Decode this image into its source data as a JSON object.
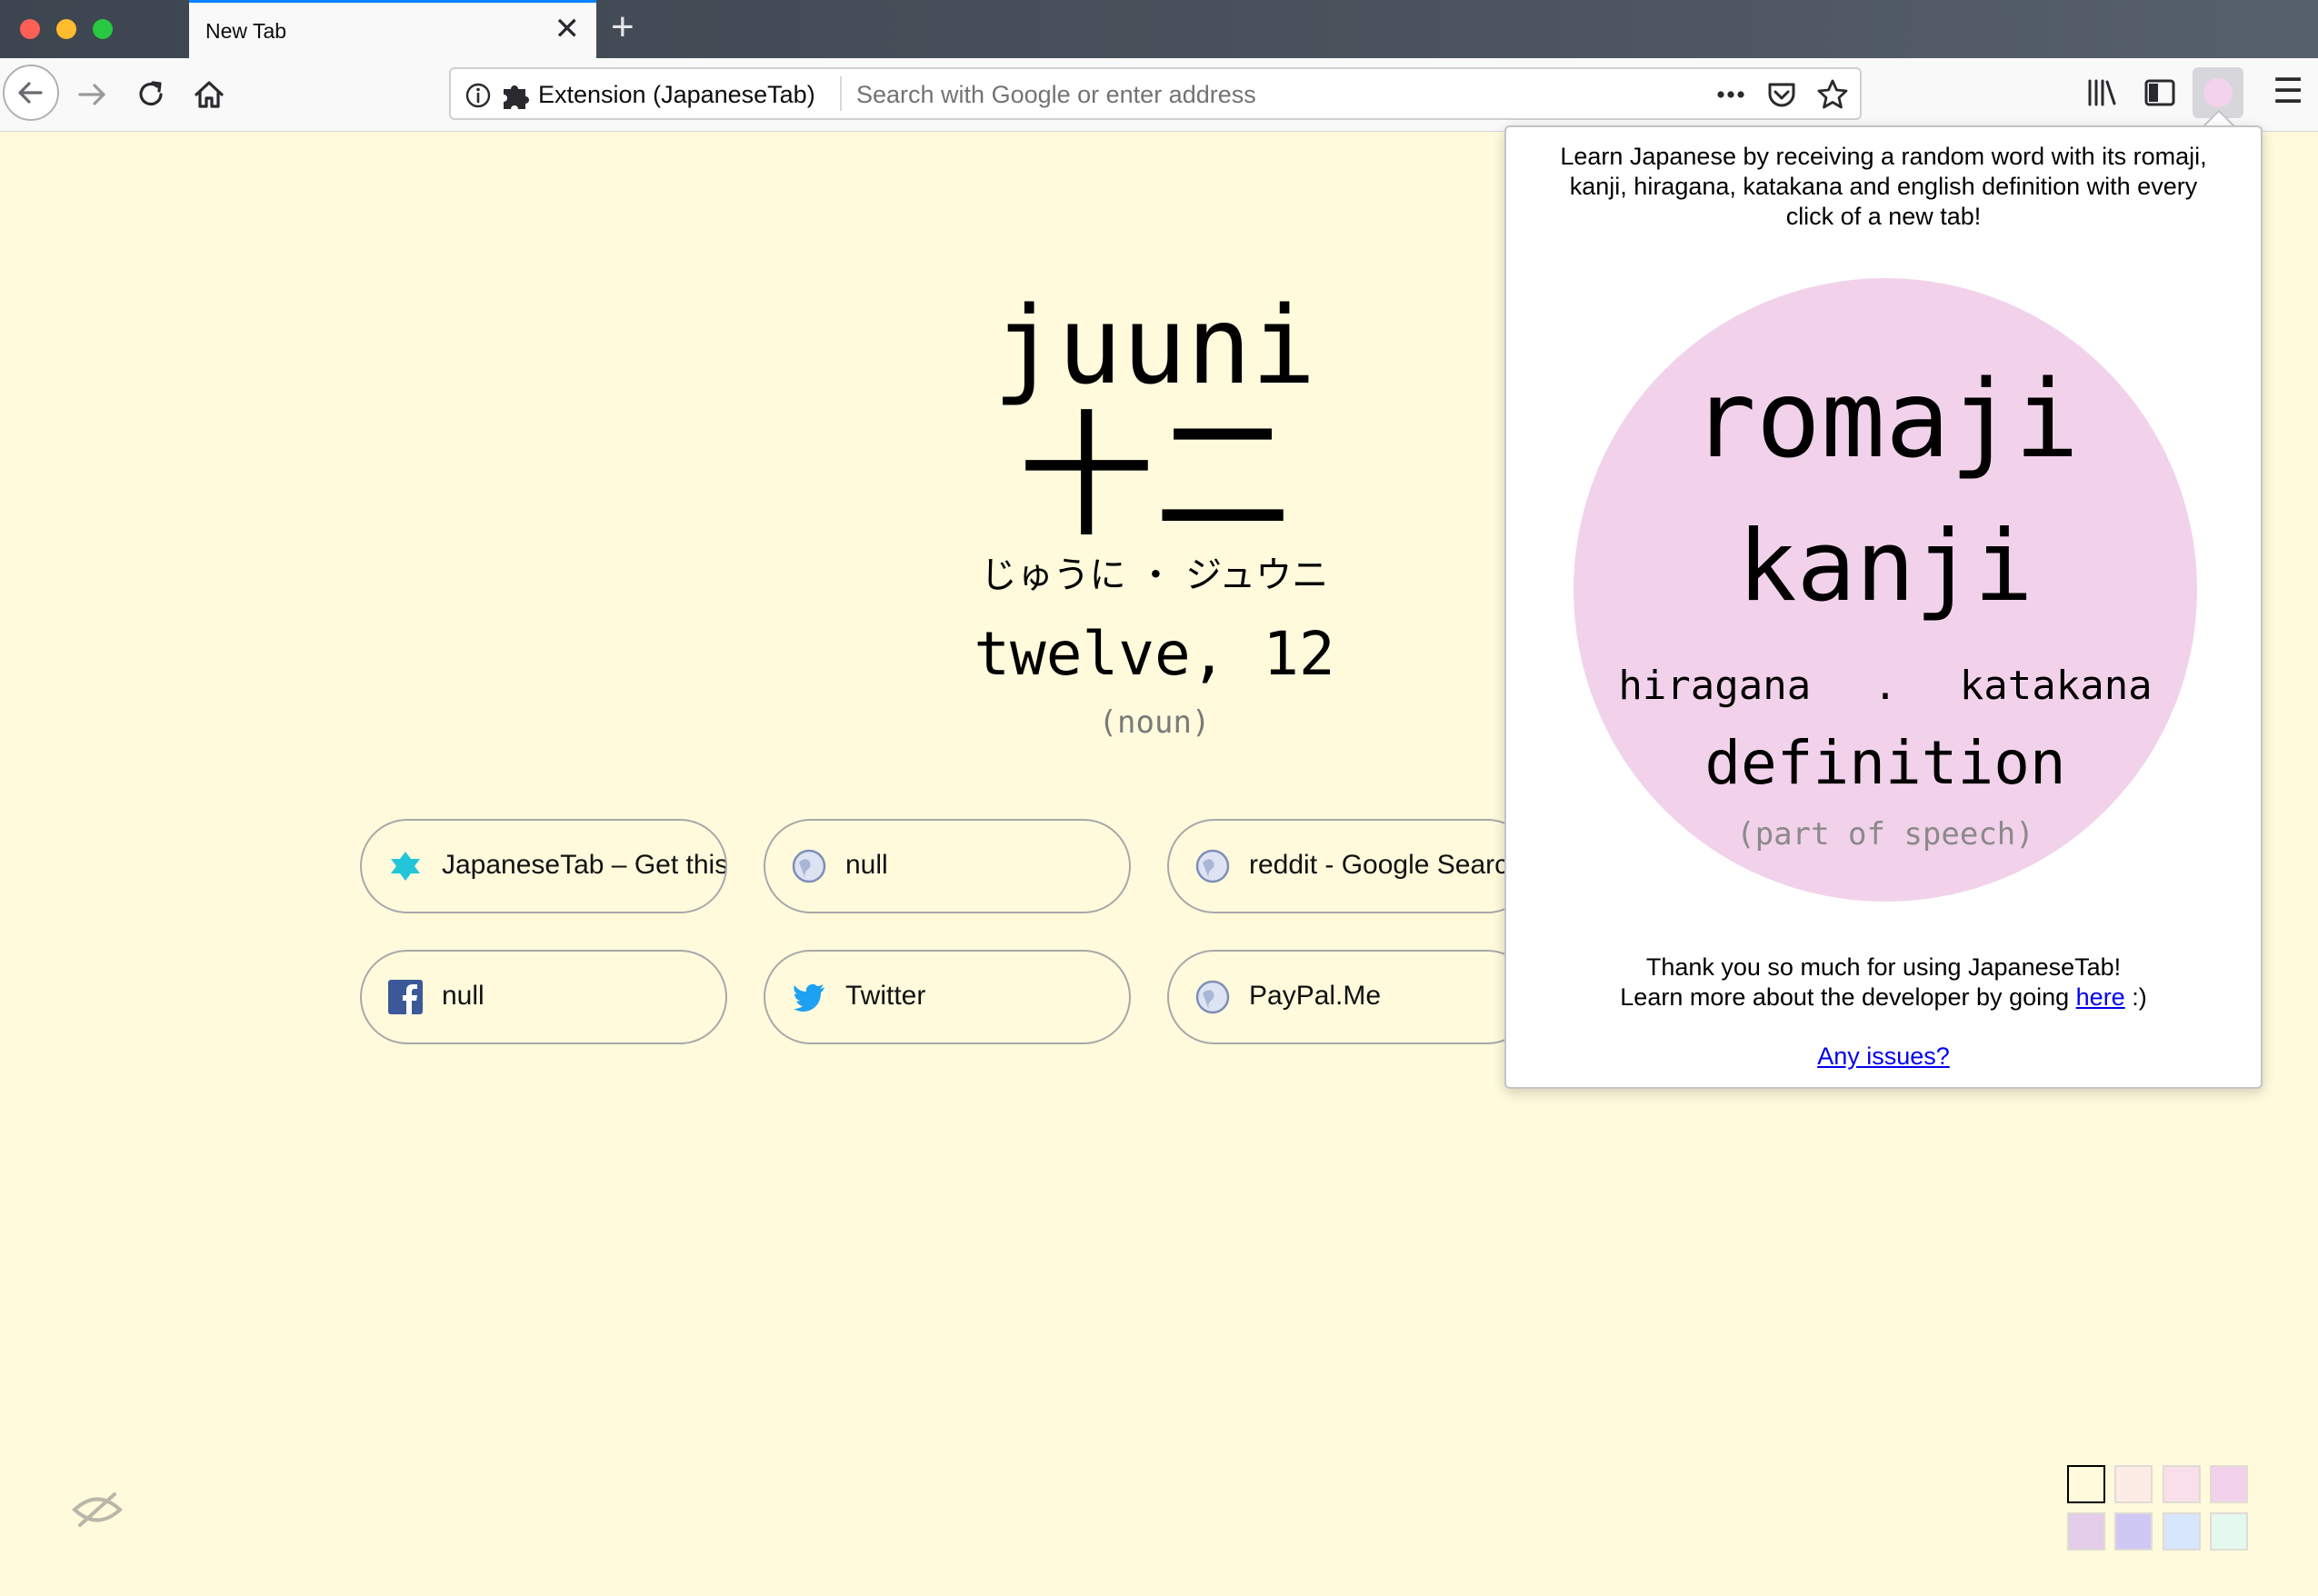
{
  "browser": {
    "tab": {
      "title": "New Tab",
      "close_glyph": "✕"
    },
    "new_tab_glyph": "+",
    "urlbar": {
      "identity_label": "Extension (JapaneseTab)",
      "placeholder": "Search with Google or enter address",
      "value": ""
    },
    "menu_glyph": "☰",
    "icons": [
      "back-arrow-icon",
      "forward-arrow-icon",
      "reload-icon",
      "home-icon",
      "info-icon",
      "puzzle-icon",
      "page-actions-icon",
      "pocket-icon",
      "bookmark-star-icon",
      "library-icon",
      "sidebar-icon",
      "extension-icon",
      "hamburger-menu-icon"
    ]
  },
  "word": {
    "romaji": "juuni",
    "kanji": "十二",
    "kana": "じゅうに ・ ジュウニ",
    "definition": "twelve, 12",
    "part_of_speech": "(noun)"
  },
  "top_sites": [
    {
      "label": "JapaneseTab – Get this",
      "icon": "japanesetab-favicon"
    },
    {
      "label": "null",
      "icon": "globe-icon"
    },
    {
      "label": "reddit - Google Search",
      "icon": "globe-icon"
    },
    {
      "label": "null",
      "icon": "facebook-icon"
    },
    {
      "label": "Twitter",
      "icon": "twitter-icon"
    },
    {
      "label": "PayPal.Me",
      "icon": "globe-icon"
    }
  ],
  "theme_swatches": [
    "#fffadc",
    "#fdebe6",
    "#f9dfe9",
    "#f2d2ea",
    "#e4cde8",
    "#cfc8f4",
    "#d8e6fb",
    "#e4f8ef"
  ],
  "popup": {
    "intro": "Learn Japanese by receiving a random word with its romaji, kanji, hiragana, katakana and english definition with every click of a new tab!",
    "sample": {
      "romaji": "romaji",
      "kanji": "kanji",
      "hiragana": "hiragana",
      "separator": ".",
      "katakana": "katakana",
      "definition": "definition",
      "part_of_speech": "(part of speech)"
    },
    "thanks_line1": "Thank you so much for using JapaneseTab!",
    "thanks_line2": "Learn more about the developer by going",
    "here_link": "here",
    "thanks_tail": " :)",
    "issues_link": "Any issues?"
  }
}
